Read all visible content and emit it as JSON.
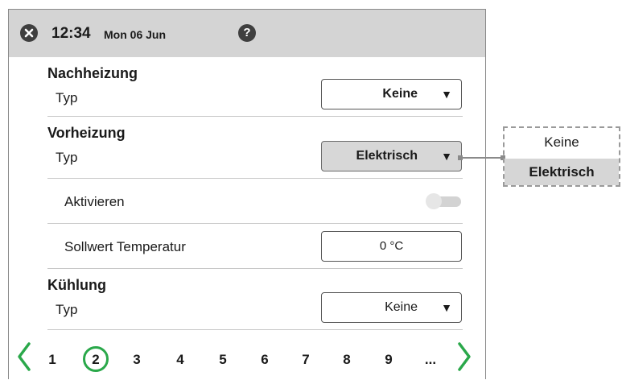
{
  "header": {
    "time": "12:34",
    "date": "Mon 06 Jun",
    "help_label": "?"
  },
  "sections": [
    {
      "title": "Nachheizung",
      "type_label": "Typ",
      "type_value": "Keine",
      "arrow": "▼"
    },
    {
      "title": "Vorheizung",
      "type_label": "Typ",
      "type_value": "Elektrisch",
      "arrow": "▼",
      "enable_label": "Aktivieren",
      "enable_on": false,
      "setpoint_label": "Sollwert Temperatur",
      "setpoint_value": "0 °C"
    },
    {
      "title": "Kühlung",
      "type_label": "Typ",
      "type_value": "Keine",
      "arrow": "▼"
    }
  ],
  "pager": {
    "pages": [
      "1",
      "2",
      "3",
      "4",
      "5",
      "6",
      "7",
      "8",
      "9",
      "..."
    ],
    "current": "2"
  },
  "popup": {
    "options": [
      "Keine",
      "Elektrisch"
    ],
    "selected": "Elektrisch"
  },
  "colors": {
    "header_bg": "#d4d4d4",
    "accent_green": "#2aa84a"
  }
}
